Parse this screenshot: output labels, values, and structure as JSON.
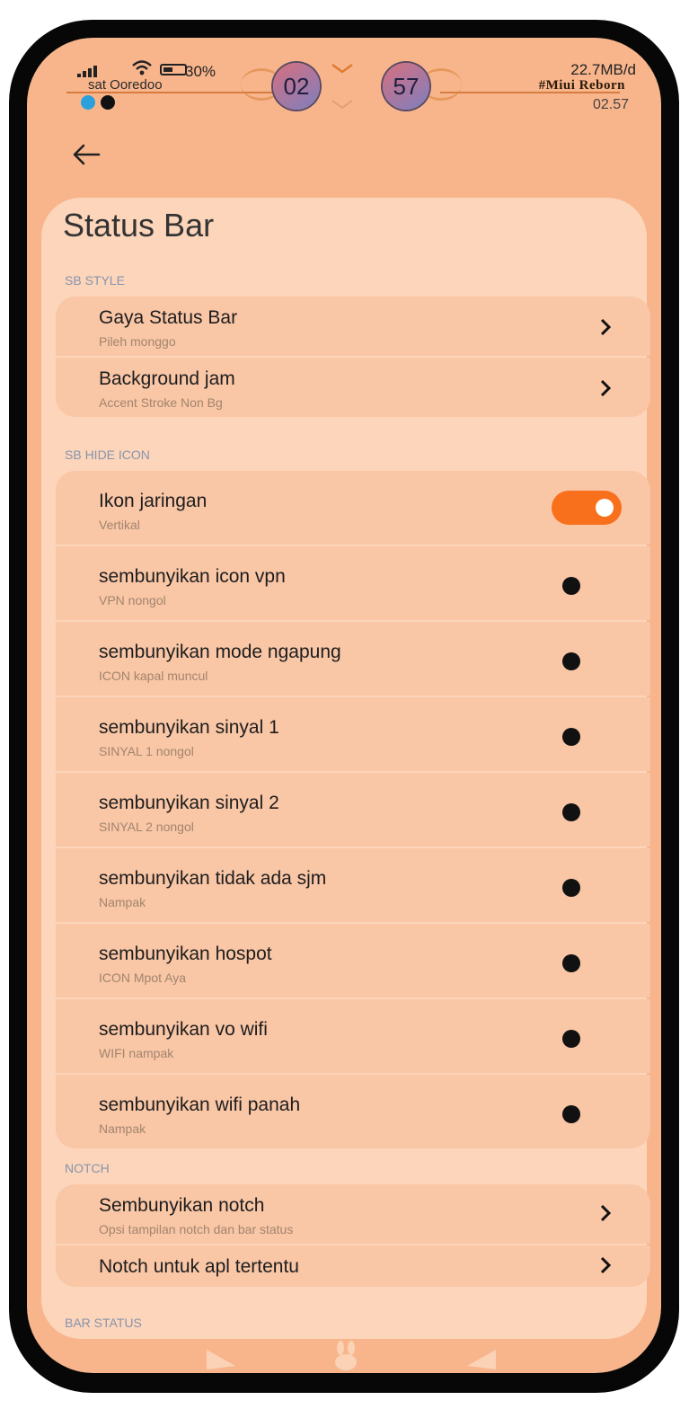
{
  "status_bar": {
    "carrier": "sat Ooredoo",
    "battery": "30%",
    "speed": "22.7MB/d",
    "brand": "#Miui Reborn",
    "time": "02.57",
    "clock_hours": "02",
    "clock_minutes": "57",
    "icons": [
      "signal-icon",
      "wifi-icon",
      "battery-icon",
      "telegram-icon",
      "terminal-icon",
      "mute-icon"
    ]
  },
  "header": {
    "title": "Status Bar"
  },
  "sections": [
    {
      "label": "SB STYLE",
      "items": [
        {
          "title": "Gaya Status Bar",
          "subtitle": "Pileh monggo",
          "control": "chevron"
        },
        {
          "title": "Background jam",
          "subtitle": "Accent Stroke Non Bg",
          "control": "chevron"
        }
      ]
    },
    {
      "label": "SB HIDE ICON",
      "items": [
        {
          "title": "Ikon jaringan",
          "subtitle": "Vertikal",
          "control": "toggle",
          "state": "on"
        },
        {
          "title": "sembunyikan icon vpn",
          "subtitle": "VPN nongol",
          "control": "dot"
        },
        {
          "title": "sembunyikan mode ngapung",
          "subtitle": "ICON kapal muncul",
          "control": "dot"
        },
        {
          "title": "sembunyikan sinyal 1",
          "subtitle": "SINYAL 1 nongol",
          "control": "dot"
        },
        {
          "title": "sembunyikan sinyal 2",
          "subtitle": "SINYAL 2 nongol",
          "control": "dot"
        },
        {
          "title": "sembunyikan tidak ada sjm",
          "subtitle": "Nampak",
          "control": "dot"
        },
        {
          "title": "sembunyikan hospot",
          "subtitle": "ICON Mpot Aya",
          "control": "dot"
        },
        {
          "title": "sembunyikan vo wifi",
          "subtitle": "WIFI nampak",
          "control": "dot"
        },
        {
          "title": "sembunyikan wifi panah",
          "subtitle": "Nampak",
          "control": "dot"
        }
      ]
    },
    {
      "label": "NOTCH",
      "items": [
        {
          "title": "Sembunyikan notch",
          "subtitle": "Opsi tampilan notch dan bar status",
          "control": "chevron"
        },
        {
          "title": "Notch untuk apl tertentu",
          "subtitle": "",
          "control": "chevron"
        }
      ]
    },
    {
      "label": "BAR STATUS",
      "items": []
    }
  ],
  "colors": {
    "background": "#f8b58c",
    "card": "#fcd5bb",
    "row": "#f9c6a6",
    "accent": "#f86f1c",
    "section_label": "#8794ac"
  }
}
